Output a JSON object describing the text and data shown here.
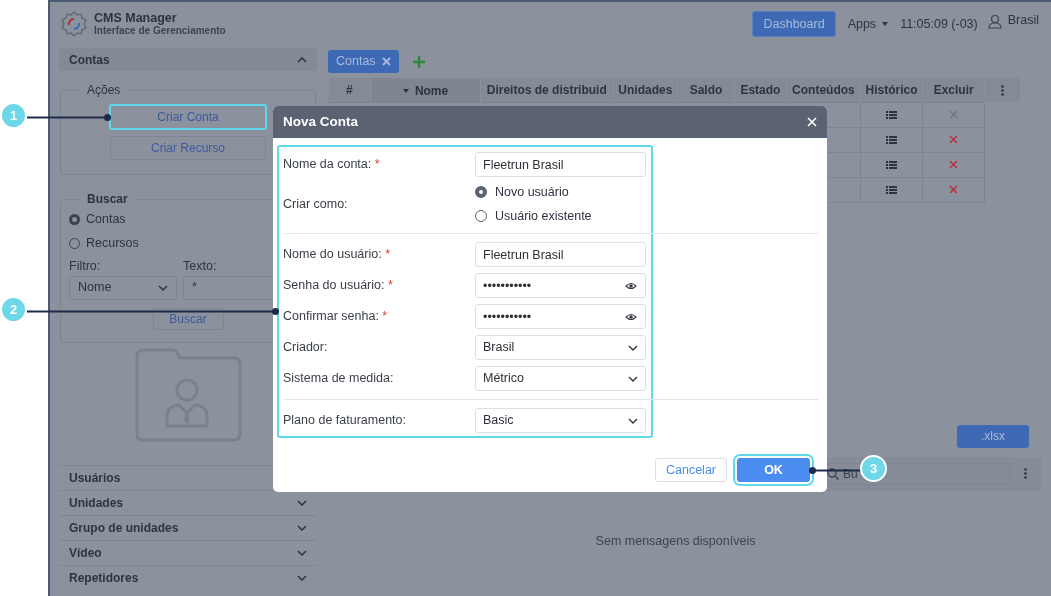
{
  "app": {
    "title": "CMS Manager",
    "subtitle": "Interface de Gerenciamento"
  },
  "header": {
    "dashboard": "Dashboard",
    "apps": "Apps",
    "time": "11:05:09 (-03)",
    "user": "Brasil"
  },
  "sidebar": {
    "panel": {
      "title": "Contas",
      "expanded": true
    },
    "actions": {
      "legend": "Ações",
      "buttons": [
        {
          "label": "Criar Conta",
          "highlighted": true
        },
        {
          "label": "Criar Recurso",
          "highlighted": false
        }
      ]
    },
    "search": {
      "legend": "Buscar",
      "options": [
        {
          "label": "Contas",
          "selected": true
        },
        {
          "label": "Recursos",
          "selected": false
        }
      ],
      "filter_label": "Filtro:",
      "filter_value": "Nome",
      "text_label": "Texto:",
      "text_value": "*",
      "button": "Buscar"
    },
    "sections": [
      {
        "title": "Usuários",
        "collapsible": false
      },
      {
        "title": "Unidades",
        "collapsible": true
      },
      {
        "title": "Grupo de unidades",
        "collapsible": true
      },
      {
        "title": "Vídeo",
        "collapsible": true
      },
      {
        "title": "Repetidores",
        "collapsible": true
      }
    ]
  },
  "tabs": [
    {
      "label": "Contas",
      "selected": true
    }
  ],
  "table": {
    "columns": [
      {
        "label": "#",
        "sorted": false
      },
      {
        "label": "Nome",
        "sorted": true
      },
      {
        "label": "Direitos de distribuid",
        "sorted": false
      },
      {
        "label": "Unidades",
        "sorted": false
      },
      {
        "label": "Saldo",
        "sorted": false
      },
      {
        "label": "Estado",
        "sorted": false
      },
      {
        "label": "Conteúdos",
        "sorted": false
      },
      {
        "label": "Histórico",
        "sorted": false
      },
      {
        "label": "Excluir",
        "sorted": false
      }
    ],
    "rows": [
      {
        "deletable": false
      },
      {
        "deletable": true
      },
      {
        "deletable": true
      },
      {
        "deletable": true
      }
    ]
  },
  "export_button": ".xlsx",
  "messages": {
    "search_placeholder": "Bu",
    "empty": "Sem mensagens disponíveis"
  },
  "dialog": {
    "title": "Nova Conta",
    "highlighted": true,
    "groups": [
      {
        "fields": [
          {
            "kind": "text",
            "label": "Nome da conta:",
            "required": true,
            "value": "Fleetrun Brasil"
          },
          {
            "kind": "radio",
            "label": "Criar como:",
            "required": false,
            "options": [
              {
                "label": "Novo usuário",
                "selected": true
              },
              {
                "label": "Usuário existente",
                "selected": false
              }
            ]
          }
        ]
      },
      {
        "fields": [
          {
            "kind": "text",
            "label": "Nome do usuário:",
            "required": true,
            "value": "Fleetrun Brasil"
          },
          {
            "kind": "password",
            "label": "Senha do usuário:",
            "required": true,
            "value": "•••••••••••"
          },
          {
            "kind": "password",
            "label": "Confirmar senha:",
            "required": true,
            "value": "•••••••••••"
          },
          {
            "kind": "select",
            "label": "Criador:",
            "required": false,
            "value": "Brasil"
          },
          {
            "kind": "select",
            "label": "Sistema de medida:",
            "required": false,
            "value": "Métrico"
          }
        ]
      },
      {
        "fields": [
          {
            "kind": "select",
            "label": "Plano de faturamento:",
            "required": false,
            "value": "Basic"
          }
        ]
      }
    ],
    "buttons": [
      {
        "label": "Cancelar",
        "kind": "secondary",
        "highlighted": false
      },
      {
        "label": "OK",
        "kind": "primary",
        "highlighted": true
      }
    ]
  },
  "callouts": [
    {
      "number": "1"
    },
    {
      "number": "2"
    },
    {
      "number": "3"
    }
  ]
}
